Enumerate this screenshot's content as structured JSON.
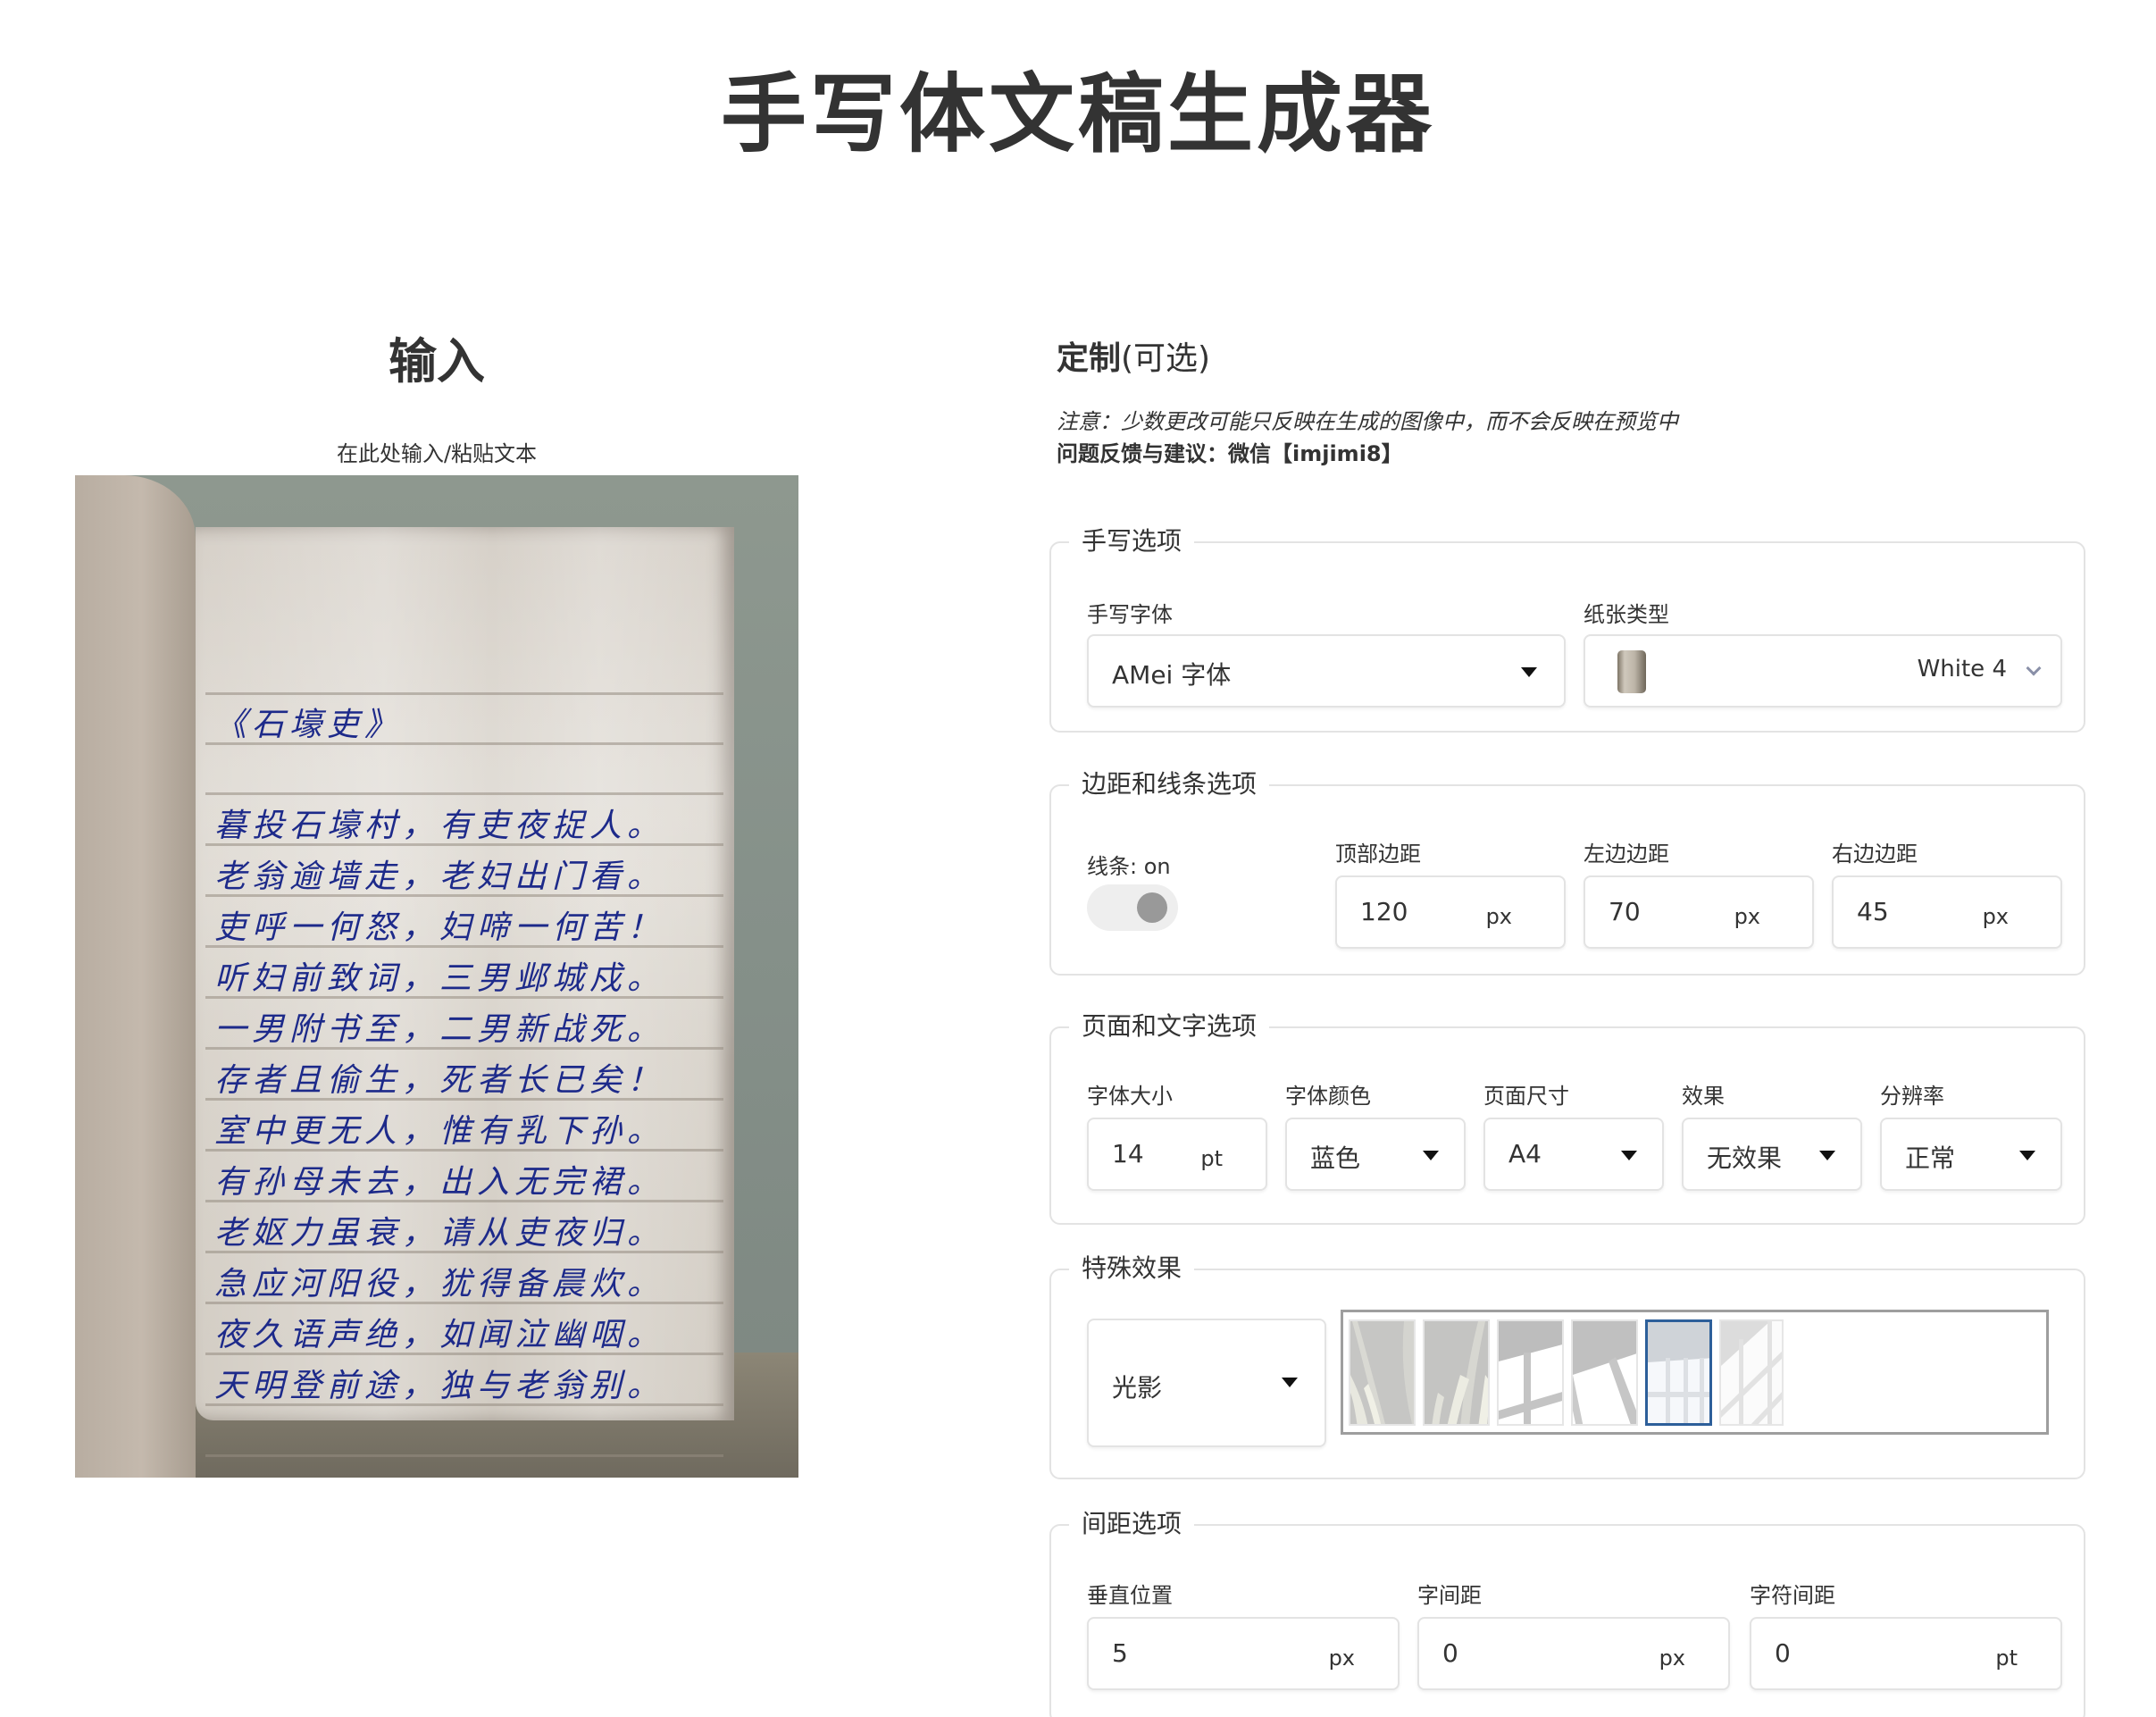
{
  "page": {
    "title": "手写体文稿生成器"
  },
  "input": {
    "heading": "输入",
    "hint": "在此处输入/粘贴文本",
    "preview": {
      "title_line": "《石壕吏》",
      "lines": [
        "暮投石壕村，有吏夜捉人。",
        "老翁逾墙走，老妇出门看。",
        "吏呼一何怒，妇啼一何苦！",
        "听妇前致词，三男邺城戍。",
        "一男附书至，二男新战死。",
        "存者且偷生，死者长已矣！",
        "室中更无人，惟有乳下孙。",
        "有孙母未去，出入无完裙。",
        "老妪力虽衰，请从吏夜归。",
        "急应河阳役，犹得备晨炊。",
        "夜久语声绝，如闻泣幽咽。",
        "天明登前途，独与老翁别。"
      ],
      "ink_color": "#1d2a8a"
    }
  },
  "customize": {
    "heading_bold": "定制",
    "heading_optional": "(可选)",
    "note": "注意：少数更改可能只反映在生成的图像中，而不会反映在预览中",
    "feedback": "问题反馈与建议：微信【imjimi8】"
  },
  "handwriting": {
    "legend": "手写选项",
    "font_label": "手写字体",
    "font_value": "AMei 字体",
    "paper_label": "纸张类型",
    "paper_value": "White 4",
    "paper_icon": "paper-swatch-icon"
  },
  "margins": {
    "legend": "边距和线条选项",
    "lines_label": "线条: on",
    "lines_on": true,
    "top_label": "顶部边距",
    "top_value": "120",
    "top_unit": "px",
    "left_label": "左边边距",
    "left_value": "70",
    "left_unit": "px",
    "right_label": "右边边距",
    "right_value": "45",
    "right_unit": "px"
  },
  "page_text": {
    "legend": "页面和文字选项",
    "size_label": "字体大小",
    "size_value": "14",
    "size_unit": "pt",
    "color_label": "字体颜色",
    "color_value": "蓝色",
    "page_label": "页面尺寸",
    "page_value": "A4",
    "effect_label": "效果",
    "effect_value": "无效果",
    "resolution_label": "分辨率",
    "resolution_value": "正常"
  },
  "special": {
    "legend": "特殊效果",
    "effect_value": "光影",
    "thumbnails": [
      "curtain-light-1",
      "curtain-light-2",
      "window-shadow-1",
      "window-shadow-2",
      "window-grid-shadow",
      "diagonal-grid-shadow"
    ],
    "selected_index": 4,
    "selected_color": "#2d5f9a"
  },
  "spacing": {
    "legend": "间距选项",
    "vertical_label": "垂直位置",
    "vertical_value": "5",
    "vertical_unit": "px",
    "word_label": "字间距",
    "word_value": "0",
    "word_unit": "px",
    "char_label": "字符间距",
    "char_value": "0",
    "char_unit": "pt"
  }
}
